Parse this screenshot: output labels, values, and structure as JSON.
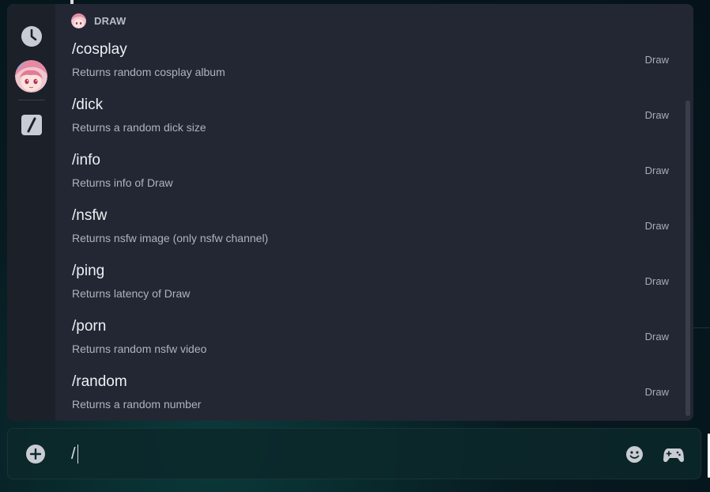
{
  "popup": {
    "section_title": "DRAW",
    "rail": {
      "items": [
        {
          "name": "clock-icon"
        },
        {
          "name": "bot-avatar"
        },
        {
          "name": "slash-commands-icon"
        }
      ]
    },
    "commands": [
      {
        "name": "/cosplay",
        "description": "Returns random cosplay album",
        "source": "Draw"
      },
      {
        "name": "/dick",
        "description": "Returns a random dick size",
        "source": "Draw"
      },
      {
        "name": "/info",
        "description": "Returns info of Draw",
        "source": "Draw"
      },
      {
        "name": "/nsfw",
        "description": "Returns nsfw image (only nsfw channel)",
        "source": "Draw"
      },
      {
        "name": "/ping",
        "description": "Returns latency of Draw",
        "source": "Draw"
      },
      {
        "name": "/porn",
        "description": "Returns random nsfw video",
        "source": "Draw"
      },
      {
        "name": "/random",
        "description": "Returns a random number",
        "source": "Draw"
      }
    ]
  },
  "input": {
    "value": "/"
  },
  "colors": {
    "popup_bg": "#232733",
    "rail_bg": "#1c2029",
    "accent_text": "#eef0f4"
  }
}
